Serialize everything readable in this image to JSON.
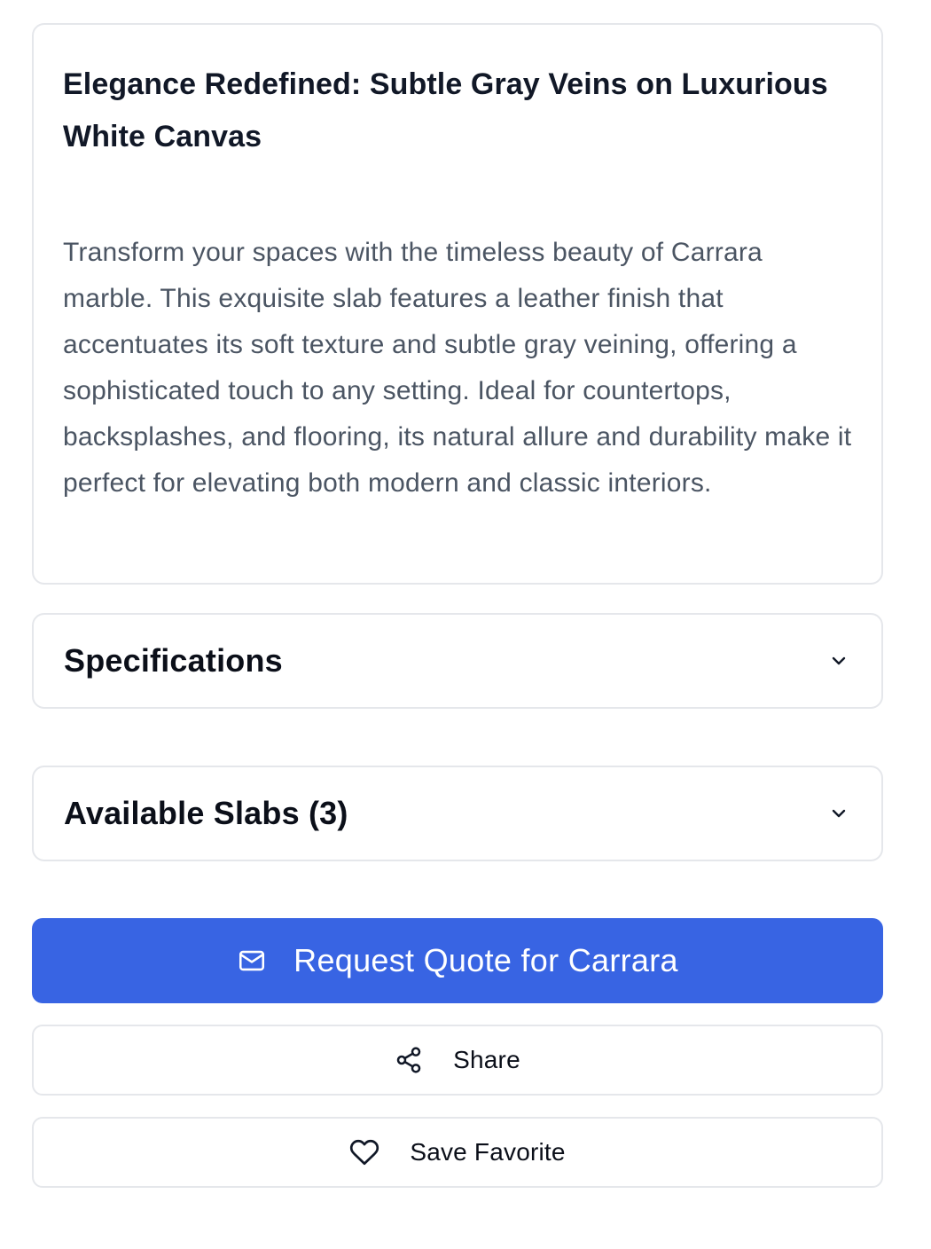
{
  "product": {
    "headline": "Elegance Redefined: Subtle Gray Veins on Luxurious White Canvas",
    "description": "Transform your spaces with the timeless beauty of Carrara marble. This exquisite slab features a leather finish that accentuates its soft texture and subtle gray veining, offering a sophisticated touch to any setting. Ideal for countertops, backsplashes, and flooring, its natural allure and durability make it perfect for elevating both modern and classic interiors."
  },
  "accordions": {
    "specifications": {
      "label": "Specifications",
      "icon": "chevron-down-icon"
    },
    "available_slabs": {
      "label": "Available Slabs (3)",
      "icon": "chevron-down-icon"
    }
  },
  "actions": {
    "request_quote": {
      "label": "Request Quote for Carrara",
      "icon": "mail-icon"
    },
    "share": {
      "label": "Share",
      "icon": "share-icon"
    },
    "save_favorite": {
      "label": "Save Favorite",
      "icon": "heart-icon"
    }
  },
  "colors": {
    "primary": "#3864e3",
    "border": "#e5e7eb",
    "text_dark": "#111827",
    "text_muted": "#4b5563"
  }
}
